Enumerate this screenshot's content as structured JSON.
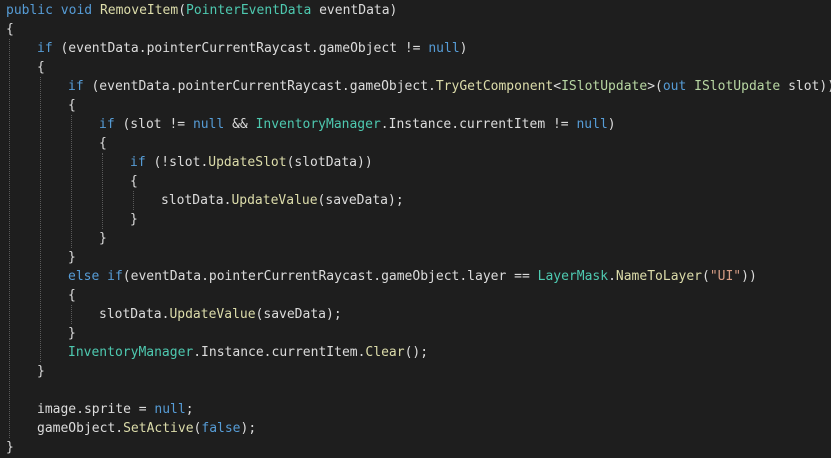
{
  "colors": {
    "background": "#1e1e1e",
    "default": "#dcdcdc",
    "keyword": "#569cd6",
    "type": "#4ec9b0",
    "interface": "#b8d7a3",
    "method": "#dcdcaa",
    "string": "#d69d85",
    "guide": "#5a5a5a"
  },
  "code_lines": [
    {
      "indent": 0,
      "tokens": [
        [
          "public",
          "keyword"
        ],
        [
          " ",
          "default"
        ],
        [
          "void",
          "keyword"
        ],
        [
          " ",
          "default"
        ],
        [
          "RemoveItem",
          "method"
        ],
        [
          "(",
          "default"
        ],
        [
          "PointerEventData",
          "type"
        ],
        [
          " eventData)",
          "default"
        ]
      ]
    },
    {
      "indent": 0,
      "tokens": [
        [
          "{",
          "default"
        ]
      ]
    },
    {
      "indent": 1,
      "tokens": [
        [
          "if",
          "keyword"
        ],
        [
          " (eventData.pointerCurrentRaycast.gameObject != ",
          "default"
        ],
        [
          "null",
          "keyword"
        ],
        [
          ")",
          "default"
        ]
      ]
    },
    {
      "indent": 1,
      "tokens": [
        [
          "{",
          "default"
        ]
      ]
    },
    {
      "indent": 2,
      "tokens": [
        [
          "if",
          "keyword"
        ],
        [
          " (eventData.pointerCurrentRaycast.gameObject.",
          "default"
        ],
        [
          "TryGetComponent",
          "method"
        ],
        [
          "<",
          "default"
        ],
        [
          "ISlotUpdate",
          "interface"
        ],
        [
          ">(",
          "default"
        ],
        [
          "out",
          "keyword"
        ],
        [
          " ",
          "default"
        ],
        [
          "ISlotUpdate",
          "interface"
        ],
        [
          " slot))",
          "default"
        ]
      ]
    },
    {
      "indent": 2,
      "tokens": [
        [
          "{",
          "default"
        ]
      ]
    },
    {
      "indent": 3,
      "tokens": [
        [
          "if",
          "keyword"
        ],
        [
          " (slot != ",
          "default"
        ],
        [
          "null",
          "keyword"
        ],
        [
          " && ",
          "default"
        ],
        [
          "InventoryManager",
          "type"
        ],
        [
          ".Instance.currentItem != ",
          "default"
        ],
        [
          "null",
          "keyword"
        ],
        [
          ")",
          "default"
        ]
      ]
    },
    {
      "indent": 3,
      "tokens": [
        [
          "{",
          "default"
        ]
      ]
    },
    {
      "indent": 4,
      "tokens": [
        [
          "if",
          "keyword"
        ],
        [
          " (!slot.",
          "default"
        ],
        [
          "UpdateSlot",
          "method"
        ],
        [
          "(slotData))",
          "default"
        ]
      ]
    },
    {
      "indent": 4,
      "tokens": [
        [
          "{",
          "default"
        ]
      ]
    },
    {
      "indent": 5,
      "tokens": [
        [
          "slotData.",
          "default"
        ],
        [
          "UpdateValue",
          "method"
        ],
        [
          "(saveData);",
          "default"
        ]
      ]
    },
    {
      "indent": 4,
      "tokens": [
        [
          "}",
          "default"
        ]
      ]
    },
    {
      "indent": 3,
      "tokens": [
        [
          "}",
          "default"
        ]
      ]
    },
    {
      "indent": 2,
      "tokens": [
        [
          "}",
          "default"
        ]
      ]
    },
    {
      "indent": 2,
      "tokens": [
        [
          "else",
          "keyword"
        ],
        [
          " ",
          "default"
        ],
        [
          "if",
          "keyword"
        ],
        [
          "(eventData.pointerCurrentRaycast.gameObject.layer == ",
          "default"
        ],
        [
          "LayerMask",
          "type"
        ],
        [
          ".",
          "default"
        ],
        [
          "NameToLayer",
          "method"
        ],
        [
          "(",
          "default"
        ],
        [
          "\"UI\"",
          "string"
        ],
        [
          "))",
          "default"
        ]
      ]
    },
    {
      "indent": 2,
      "tokens": [
        [
          "{",
          "default"
        ]
      ]
    },
    {
      "indent": 3,
      "tokens": [
        [
          "slotData.",
          "default"
        ],
        [
          "UpdateValue",
          "method"
        ],
        [
          "(saveData);",
          "default"
        ]
      ]
    },
    {
      "indent": 2,
      "tokens": [
        [
          "}",
          "default"
        ]
      ]
    },
    {
      "indent": 2,
      "tokens": [
        [
          "InventoryManager",
          "type"
        ],
        [
          ".Instance.currentItem.",
          "default"
        ],
        [
          "Clear",
          "method"
        ],
        [
          "();",
          "default"
        ]
      ]
    },
    {
      "indent": 1,
      "tokens": [
        [
          "}",
          "default"
        ]
      ]
    },
    {
      "indent": 0,
      "tokens": []
    },
    {
      "indent": 1,
      "tokens": [
        [
          "image.sprite = ",
          "default"
        ],
        [
          "null",
          "keyword"
        ],
        [
          ";",
          "default"
        ]
      ]
    },
    {
      "indent": 1,
      "tokens": [
        [
          "gameObject.",
          "default"
        ],
        [
          "SetActive",
          "method"
        ],
        [
          "(",
          "default"
        ],
        [
          "false",
          "keyword"
        ],
        [
          ");",
          "default"
        ]
      ]
    },
    {
      "indent": 0,
      "tokens": [
        [
          "}",
          "default"
        ]
      ]
    }
  ]
}
